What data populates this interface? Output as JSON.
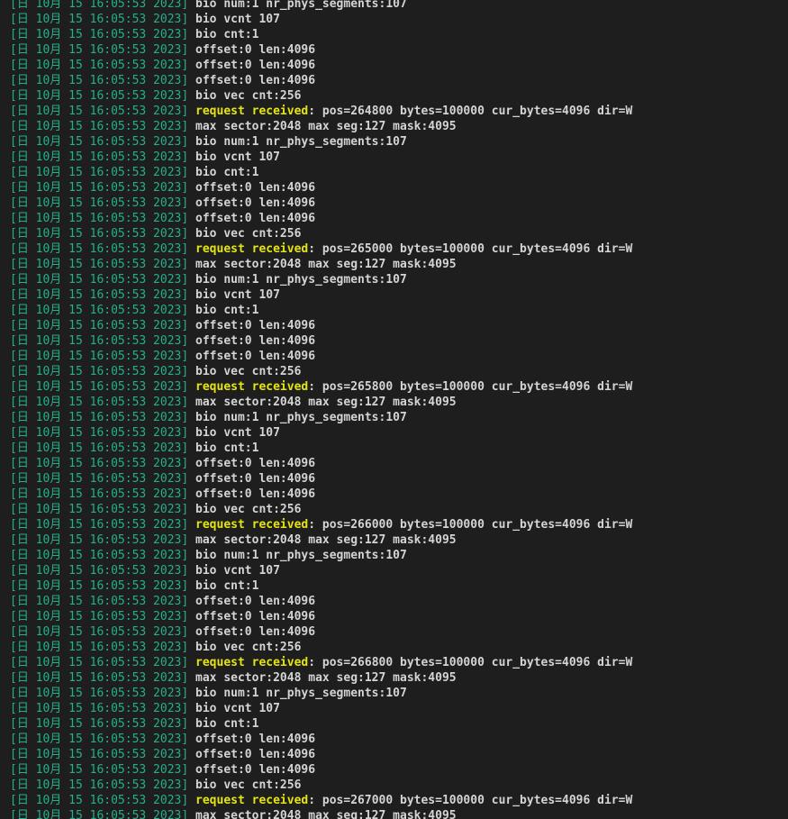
{
  "terminal": {
    "lines": [
      {
        "ts": "[日 10月 15 16:05:53 2023]",
        "msg": "bio num:1 nr_phys_segments:107"
      },
      {
        "ts": "[日 10月 15 16:05:53 2023]",
        "msg": "bio vcnt 107"
      },
      {
        "ts": "[日 10月 15 16:05:53 2023]",
        "msg": "bio cnt:1"
      },
      {
        "ts": "[日 10月 15 16:05:53 2023]",
        "msg": "offset:0 len:4096"
      },
      {
        "ts": "[日 10月 15 16:05:53 2023]",
        "msg": "offset:0 len:4096"
      },
      {
        "ts": "[日 10月 15 16:05:53 2023]",
        "msg": "offset:0 len:4096"
      },
      {
        "ts": "[日 10月 15 16:05:53 2023]",
        "msg": "bio vec cnt:256"
      },
      {
        "ts": "[日 10月 15 16:05:53 2023]",
        "hl": "request received",
        "msg": ": pos=264800 bytes=100000 cur_bytes=4096 dir=W"
      },
      {
        "ts": "[日 10月 15 16:05:53 2023]",
        "msg": "max sector:2048 max seg:127 mask:4095"
      },
      {
        "ts": "[日 10月 15 16:05:53 2023]",
        "msg": "bio num:1 nr_phys_segments:107"
      },
      {
        "ts": "[日 10月 15 16:05:53 2023]",
        "msg": "bio vcnt 107"
      },
      {
        "ts": "[日 10月 15 16:05:53 2023]",
        "msg": "bio cnt:1"
      },
      {
        "ts": "[日 10月 15 16:05:53 2023]",
        "msg": "offset:0 len:4096"
      },
      {
        "ts": "[日 10月 15 16:05:53 2023]",
        "msg": "offset:0 len:4096"
      },
      {
        "ts": "[日 10月 15 16:05:53 2023]",
        "msg": "offset:0 len:4096"
      },
      {
        "ts": "[日 10月 15 16:05:53 2023]",
        "msg": "bio vec cnt:256"
      },
      {
        "ts": "[日 10月 15 16:05:53 2023]",
        "hl": "request received",
        "msg": ": pos=265000 bytes=100000 cur_bytes=4096 dir=W"
      },
      {
        "ts": "[日 10月 15 16:05:53 2023]",
        "msg": "max sector:2048 max seg:127 mask:4095"
      },
      {
        "ts": "[日 10月 15 16:05:53 2023]",
        "msg": "bio num:1 nr_phys_segments:107"
      },
      {
        "ts": "[日 10月 15 16:05:53 2023]",
        "msg": "bio vcnt 107"
      },
      {
        "ts": "[日 10月 15 16:05:53 2023]",
        "msg": "bio cnt:1"
      },
      {
        "ts": "[日 10月 15 16:05:53 2023]",
        "msg": "offset:0 len:4096"
      },
      {
        "ts": "[日 10月 15 16:05:53 2023]",
        "msg": "offset:0 len:4096"
      },
      {
        "ts": "[日 10月 15 16:05:53 2023]",
        "msg": "offset:0 len:4096"
      },
      {
        "ts": "[日 10月 15 16:05:53 2023]",
        "msg": "bio vec cnt:256"
      },
      {
        "ts": "[日 10月 15 16:05:53 2023]",
        "hl": "request received",
        "msg": ": pos=265800 bytes=100000 cur_bytes=4096 dir=W"
      },
      {
        "ts": "[日 10月 15 16:05:53 2023]",
        "msg": "max sector:2048 max seg:127 mask:4095"
      },
      {
        "ts": "[日 10月 15 16:05:53 2023]",
        "msg": "bio num:1 nr_phys_segments:107"
      },
      {
        "ts": "[日 10月 15 16:05:53 2023]",
        "msg": "bio vcnt 107"
      },
      {
        "ts": "[日 10月 15 16:05:53 2023]",
        "msg": "bio cnt:1"
      },
      {
        "ts": "[日 10月 15 16:05:53 2023]",
        "msg": "offset:0 len:4096"
      },
      {
        "ts": "[日 10月 15 16:05:53 2023]",
        "msg": "offset:0 len:4096"
      },
      {
        "ts": "[日 10月 15 16:05:53 2023]",
        "msg": "offset:0 len:4096"
      },
      {
        "ts": "[日 10月 15 16:05:53 2023]",
        "msg": "bio vec cnt:256"
      },
      {
        "ts": "[日 10月 15 16:05:53 2023]",
        "hl": "request received",
        "msg": ": pos=266000 bytes=100000 cur_bytes=4096 dir=W"
      },
      {
        "ts": "[日 10月 15 16:05:53 2023]",
        "msg": "max sector:2048 max seg:127 mask:4095"
      },
      {
        "ts": "[日 10月 15 16:05:53 2023]",
        "msg": "bio num:1 nr_phys_segments:107"
      },
      {
        "ts": "[日 10月 15 16:05:53 2023]",
        "msg": "bio vcnt 107"
      },
      {
        "ts": "[日 10月 15 16:05:53 2023]",
        "msg": "bio cnt:1"
      },
      {
        "ts": "[日 10月 15 16:05:53 2023]",
        "msg": "offset:0 len:4096"
      },
      {
        "ts": "[日 10月 15 16:05:53 2023]",
        "msg": "offset:0 len:4096"
      },
      {
        "ts": "[日 10月 15 16:05:53 2023]",
        "msg": "offset:0 len:4096"
      },
      {
        "ts": "[日 10月 15 16:05:53 2023]",
        "msg": "bio vec cnt:256"
      },
      {
        "ts": "[日 10月 15 16:05:53 2023]",
        "hl": "request received",
        "msg": ": pos=266800 bytes=100000 cur_bytes=4096 dir=W"
      },
      {
        "ts": "[日 10月 15 16:05:53 2023]",
        "msg": "max sector:2048 max seg:127 mask:4095"
      },
      {
        "ts": "[日 10月 15 16:05:53 2023]",
        "msg": "bio num:1 nr_phys_segments:107"
      },
      {
        "ts": "[日 10月 15 16:05:53 2023]",
        "msg": "bio vcnt 107"
      },
      {
        "ts": "[日 10月 15 16:05:53 2023]",
        "msg": "bio cnt:1"
      },
      {
        "ts": "[日 10月 15 16:05:53 2023]",
        "msg": "offset:0 len:4096"
      },
      {
        "ts": "[日 10月 15 16:05:53 2023]",
        "msg": "offset:0 len:4096"
      },
      {
        "ts": "[日 10月 15 16:05:53 2023]",
        "msg": "offset:0 len:4096"
      },
      {
        "ts": "[日 10月 15 16:05:53 2023]",
        "msg": "bio vec cnt:256"
      },
      {
        "ts": "[日 10月 15 16:05:53 2023]",
        "hl": "request received",
        "msg": ": pos=267000 bytes=100000 cur_bytes=4096 dir=W"
      },
      {
        "ts": "[日 10月 15 16:05:53 2023]",
        "msg": "max sector:2048 max seg:127 mask:4095"
      }
    ]
  }
}
